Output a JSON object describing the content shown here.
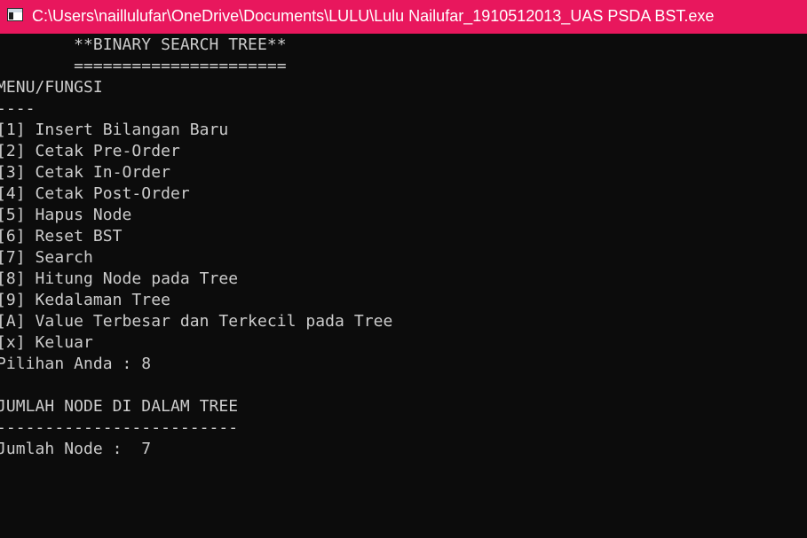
{
  "window": {
    "title": "C:\\Users\\naillulufar\\OneDrive\\Documents\\LULU\\Lulu Nailufar_1910512013_UAS PSDA BST.exe",
    "titlebar_color": "#e8175d",
    "icon": "console-app-icon"
  },
  "console": {
    "background": "#0c0c0c",
    "text_color": "#cccccc",
    "header_title": "        **BINARY SEARCH TREE**",
    "header_underline": "        ======================",
    "menu_title": "MENU/FUNGSI",
    "menu_rule": "----",
    "menu_items": [
      "[1] Insert Bilangan Baru",
      "[2] Cetak Pre-Order",
      "[3] Cetak In-Order",
      "[4] Cetak Post-Order",
      "[5] Hapus Node",
      "[6] Reset BST",
      "[7] Search",
      "[8] Hitung Node pada Tree",
      "[9] Kedalaman Tree",
      "[A] Value Terbesar dan Terkecil pada Tree",
      "[x] Keluar"
    ],
    "prompt": "Pilihan Anda : 8",
    "result_title": "JUMLAH NODE DI DALAM TREE",
    "result_rule": "-------------------------",
    "result_value": "Jumlah Node :  7"
  }
}
